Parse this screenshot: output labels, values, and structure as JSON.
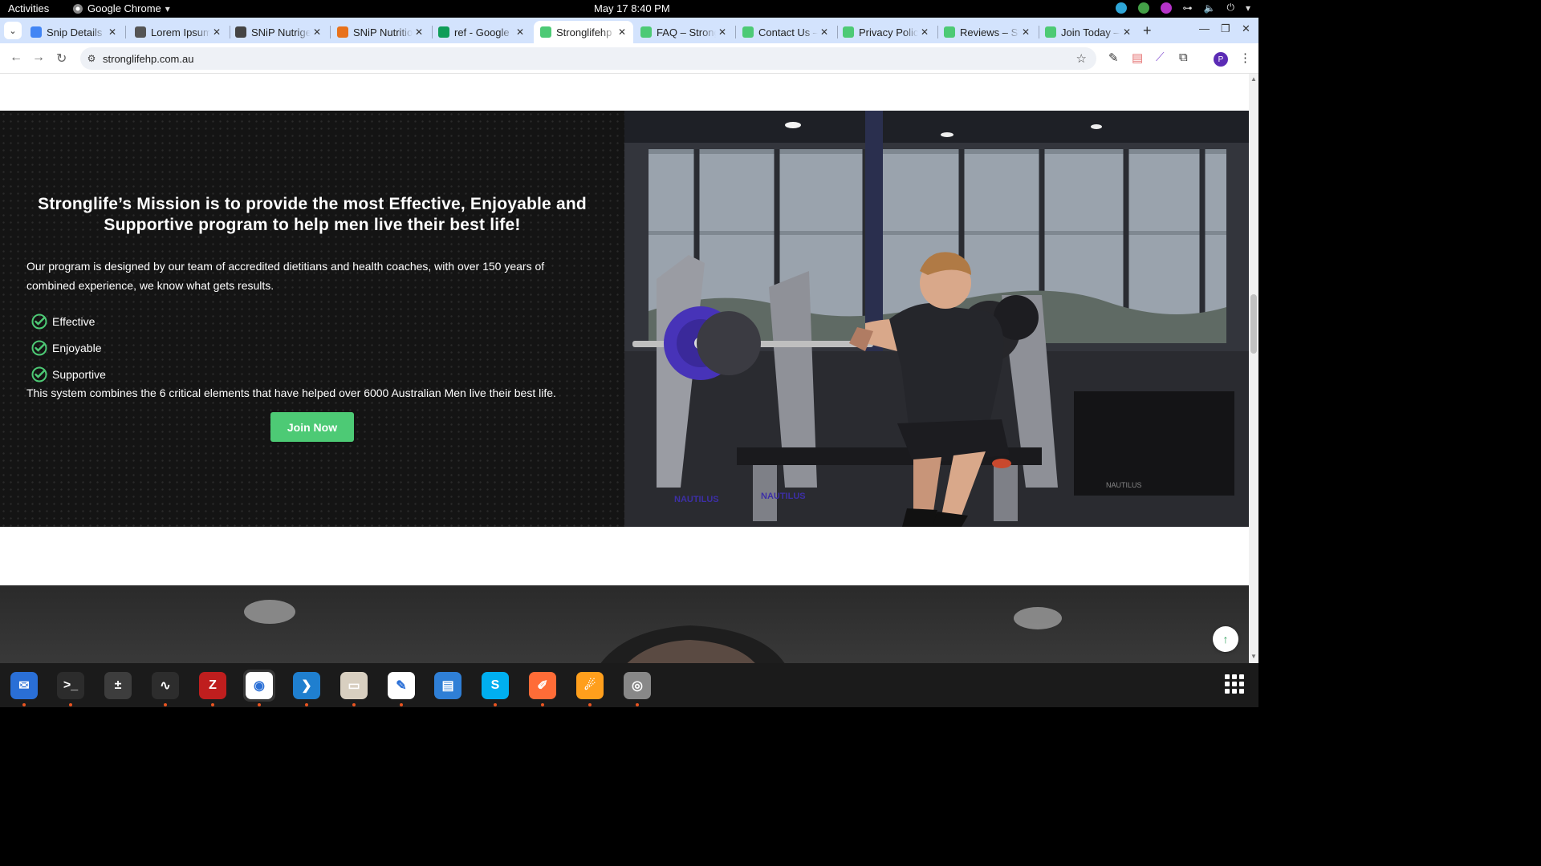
{
  "topbar": {
    "activities": "Activities",
    "app_name": "Google Chrome",
    "clock": "May 17  8:40 PM"
  },
  "tabs": [
    {
      "label": "Snip Details",
      "favicon_color": "#4285f4",
      "icon": "docs-icon"
    },
    {
      "label": "Lorem Ipsum",
      "favicon_color": "#555555",
      "icon": "lorem-icon"
    },
    {
      "label": "SNiP Nutrigenomics",
      "favicon_color": "#444444",
      "icon": "snip-icon"
    },
    {
      "label": "SNiP Nutrition",
      "favicon_color": "#e8711a",
      "icon": "snip-orange-icon"
    },
    {
      "label": "ref - Google Sheets",
      "favicon_color": "#0f9d58",
      "icon": "sheets-icon"
    },
    {
      "label": "Stronglifehp",
      "favicon_color": "#4dca75",
      "icon": "stronglife-icon",
      "active": true
    },
    {
      "label": "FAQ – Stronglife",
      "favicon_color": "#4dca75",
      "icon": "stronglife-icon"
    },
    {
      "label": "Contact Us – Stronglife",
      "favicon_color": "#4dca75",
      "icon": "stronglife-icon"
    },
    {
      "label": "Privacy Policy",
      "favicon_color": "#4dca75",
      "icon": "stronglife-icon"
    },
    {
      "label": "Reviews – Stronglife",
      "favicon_color": "#4dca75",
      "icon": "stronglife-icon"
    },
    {
      "label": "Join Today – Stronglife",
      "favicon_color": "#4dca75",
      "icon": "stronglife-icon"
    }
  ],
  "address_bar": {
    "url": "stronglifehp.com.au",
    "profile_initial": "P"
  },
  "mission": {
    "heading": "Stronglife’s Mission is to provide the most Effective, Enjoyable and Supportive program to help men live their best life!",
    "lead": "Our program is designed by our team of accredited dietitians and health coaches, with over 150 years of combined experience, we know what gets results.",
    "checklist": [
      "Effective",
      "Enjoyable",
      "Supportive"
    ],
    "system_text": "This system combines the 6 critical elements that have helped over 6000 Australian Men live their best life.",
    "cta": "Join Now",
    "accent_color": "#4dca75"
  },
  "photo": {
    "equipment_brand": "NAUTILUS"
  },
  "dock": [
    {
      "name": "thunderbird-icon",
      "color": "#2a6fd6"
    },
    {
      "name": "terminal-icon",
      "color": "#2c2c2c"
    },
    {
      "name": "calculator-icon",
      "color": "#3d3d3d"
    },
    {
      "name": "system-monitor-icon",
      "color": "#2d2d2d"
    },
    {
      "name": "filezilla-icon",
      "color": "#bf1e1e"
    },
    {
      "name": "chrome-icon",
      "color": "#ffffff"
    },
    {
      "name": "vscode-icon",
      "color": "#1f7fcf"
    },
    {
      "name": "files-icon",
      "color": "#d8cfc0"
    },
    {
      "name": "text-editor-icon",
      "color": "#ffffff"
    },
    {
      "name": "libreoffice-writer-icon",
      "color": "#2f7fd6"
    },
    {
      "name": "skype-icon",
      "color": "#00aff0"
    },
    {
      "name": "postman-icon",
      "color": "#ff6c37"
    },
    {
      "name": "firefox-dev-icon",
      "color": "#ff9f1c"
    },
    {
      "name": "disk-icon",
      "color": "#888888"
    }
  ]
}
